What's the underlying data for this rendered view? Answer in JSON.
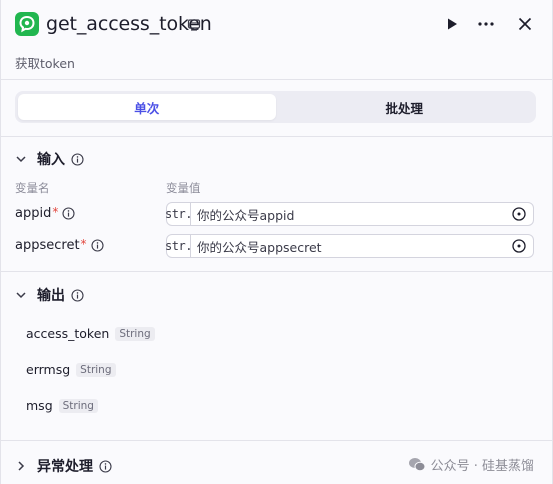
{
  "node": {
    "title": "get_access_token",
    "description": "获取token"
  },
  "tabs": [
    {
      "label": "单次",
      "active": true
    },
    {
      "label": "批处理",
      "active": false
    }
  ],
  "input_section": {
    "title": "输入",
    "col_name": "变量名",
    "col_value": "变量值",
    "rows": [
      {
        "name": "appid",
        "required": "*",
        "type": "str.",
        "value": "你的公众号appid"
      },
      {
        "name": "appsecret",
        "required": "*",
        "type": "str.",
        "value": "你的公众号appsecret"
      }
    ]
  },
  "output_section": {
    "title": "输出",
    "rows": [
      {
        "name": "access_token",
        "type": "String"
      },
      {
        "name": "errmsg",
        "type": "String"
      },
      {
        "name": "msg",
        "type": "String"
      }
    ]
  },
  "exception_section": {
    "title": "异常处理"
  },
  "watermark": "公众号 · 硅基蒸馏",
  "colors": {
    "accent": "#4b50e6",
    "node_icon": "#21b64f",
    "required": "#e2453c"
  },
  "icons": [
    "node-icon",
    "edit-icon",
    "play-icon",
    "more-icon",
    "close-icon",
    "chevron-down-icon",
    "chevron-right-icon",
    "info-icon",
    "variable-ref-icon",
    "wechat-icon"
  ]
}
